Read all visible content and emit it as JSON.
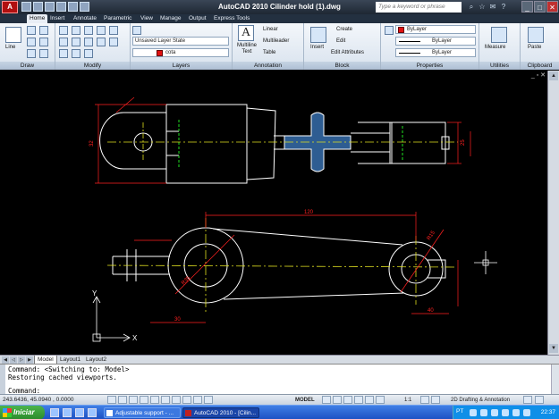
{
  "window": {
    "title": "AutoCAD 2010    Cilinder hold (1).dwg",
    "search_placeholder": "Type a keyword or phrase",
    "app_button": "A"
  },
  "ribbon_tabs": [
    "Home",
    "Insert",
    "Annotate",
    "Parametric",
    "View",
    "Manage",
    "Output",
    "Express Tools"
  ],
  "panels": {
    "draw": {
      "title": "Draw",
      "tools": [
        "Line"
      ]
    },
    "modify": {
      "title": "Modify"
    },
    "layers": {
      "title": "Layers",
      "layer_state": "Unsaved Layer State",
      "current_layer": "cota"
    },
    "annotation": {
      "title": "Annotation",
      "multiline_text": "Multiline\nText",
      "linear": "Linear",
      "multileader": "Multileader",
      "table": "Table"
    },
    "block": {
      "title": "Block",
      "insert": "Insert",
      "create": "Create",
      "edit": "Edit",
      "edit_attributes": "Edit Attributes"
    },
    "properties": {
      "title": "Properties",
      "color": "ByLayer",
      "linetype": "ByLayer",
      "lineweight": "ByLayer"
    },
    "utilities": {
      "title": "Utilities",
      "measure": "Measure"
    },
    "clipboard": {
      "title": "Clipboard",
      "paste": "Paste"
    }
  },
  "layout_tabs": [
    "Model",
    "Layout1",
    "Layout2"
  ],
  "command_lines": [
    "Command:  <Switching to: Model>",
    "Restoring cached viewports.",
    "",
    "Command:"
  ],
  "status": {
    "coordinates": "243.6436, 45.0940 , 0.0000",
    "space": "MODEL",
    "scale": "1:1",
    "workspace": "2D Drafting & Annotation"
  },
  "taskbar": {
    "start": "Iniciar",
    "buttons": [
      "Adjustable support - ...",
      "AutoCAD 2010 - [Cilin..."
    ],
    "language": "PT",
    "clock": "22:37"
  },
  "drawing": {
    "dimensions": [
      "120",
      "32",
      "25",
      "30",
      "40",
      "R15",
      "R35"
    ],
    "axis_labels": {
      "x": "X",
      "y": "Y"
    }
  },
  "colors": {
    "canvas": "#000000",
    "geometry": "#ffffff",
    "dimension": "#ff2020",
    "centerline": "#e0e020",
    "hidden": "#20e020",
    "hatch": "#3a6ea8"
  }
}
